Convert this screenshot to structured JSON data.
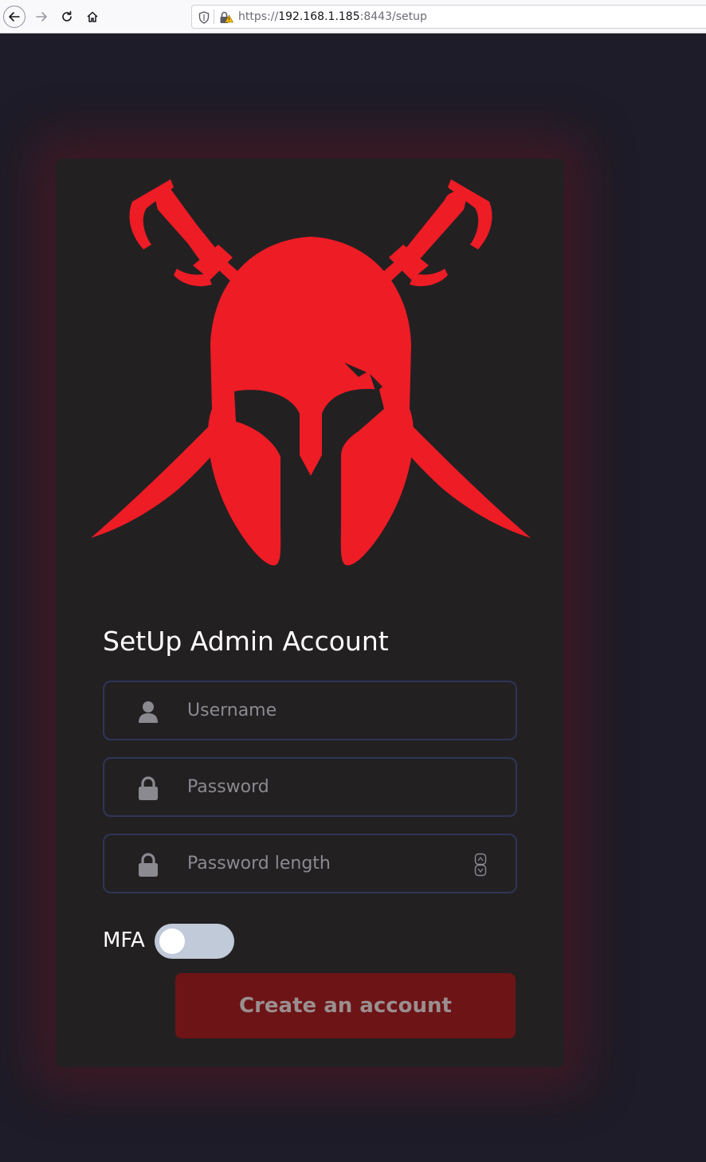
{
  "browser": {
    "url_prefix": "https://",
    "url_host": "192.168.1.185",
    "url_rest": ":8443/setup"
  },
  "form": {
    "title": "SetUp Admin Account",
    "username": {
      "placeholder": "Username",
      "value": "",
      "icon": "user-icon"
    },
    "password": {
      "placeholder": "Password",
      "value": "",
      "icon": "lock-icon"
    },
    "password_length": {
      "placeholder": "Password length",
      "value": "",
      "icon": "lock-icon"
    },
    "mfa_label": "MFA",
    "mfa_enabled": false,
    "submit_label": "Create an account"
  },
  "colors": {
    "brand_red": "#ee1c25",
    "button_bg": "#6d1416",
    "card_bg": "#232022",
    "page_bg": "#1d1c28"
  },
  "logo": {
    "icon": "spartan-helmet-crossed-swords-logo"
  }
}
